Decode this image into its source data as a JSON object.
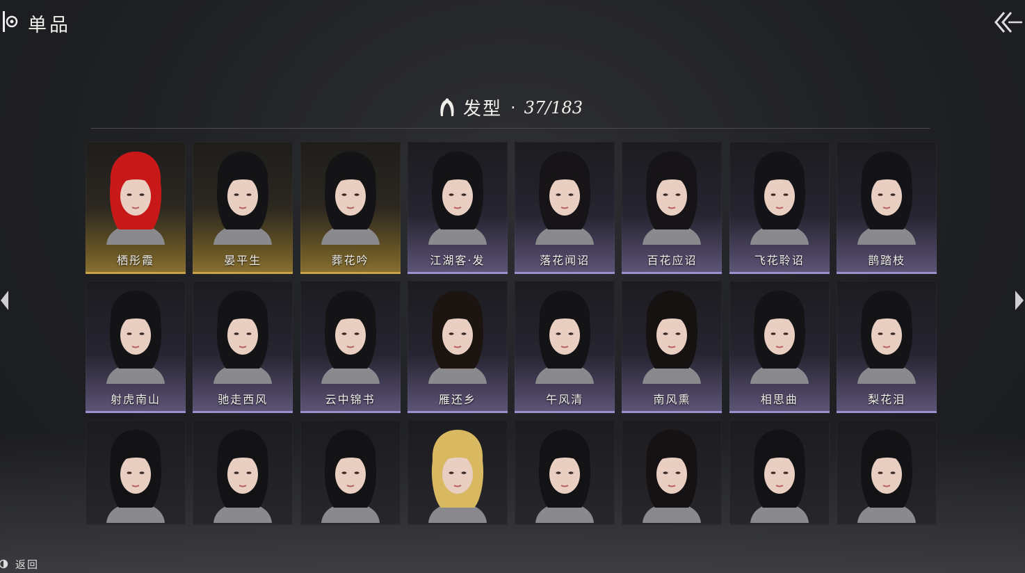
{
  "header": {
    "title": "单品"
  },
  "section": {
    "category": "发型",
    "separator": "·",
    "count": "37/183"
  },
  "cards": [
    {
      "name": "栖彤霞",
      "rarity": "gold",
      "hair": "#c81818"
    },
    {
      "name": "晏平生",
      "rarity": "gold",
      "hair": "#141416"
    },
    {
      "name": "葬花吟",
      "rarity": "gold",
      "hair": "#141416"
    },
    {
      "name": "江湖客·发",
      "rarity": "purple",
      "hair": "#141416"
    },
    {
      "name": "落花闻诏",
      "rarity": "purple",
      "hair": "#161416"
    },
    {
      "name": "百花应诏",
      "rarity": "purple",
      "hair": "#161416"
    },
    {
      "name": "飞花聆诏",
      "rarity": "purple",
      "hair": "#141418"
    },
    {
      "name": "鹊踏枝",
      "rarity": "purple",
      "hair": "#141418"
    },
    {
      "name": "射虎南山",
      "rarity": "purple",
      "hair": "#141416"
    },
    {
      "name": "驰走西风",
      "rarity": "purple",
      "hair": "#141416"
    },
    {
      "name": "云中锦书",
      "rarity": "purple",
      "hair": "#141416"
    },
    {
      "name": "雁还乡",
      "rarity": "purple",
      "hair": "#1c1410"
    },
    {
      "name": "午风清",
      "rarity": "purple",
      "hair": "#141416"
    },
    {
      "name": "南风熏",
      "rarity": "purple",
      "hair": "#161212"
    },
    {
      "name": "相思曲",
      "rarity": "purple",
      "hair": "#141416"
    },
    {
      "name": "梨花泪",
      "rarity": "purple",
      "hair": "#141416"
    },
    {
      "name": "",
      "rarity": "plain",
      "hair": "#131315"
    },
    {
      "name": "",
      "rarity": "plain",
      "hair": "#131315"
    },
    {
      "name": "",
      "rarity": "plain",
      "hair": "#131315"
    },
    {
      "name": "",
      "rarity": "plain",
      "hair": "#d8b860"
    },
    {
      "name": "",
      "rarity": "plain",
      "hair": "#131315"
    },
    {
      "name": "",
      "rarity": "plain",
      "hair": "#161214"
    },
    {
      "name": "",
      "rarity": "plain",
      "hair": "#131315"
    },
    {
      "name": "",
      "rarity": "plain",
      "hair": "#131315"
    }
  ],
  "footer": {
    "back_label": "返回"
  },
  "icons": {
    "logo": "logo-icon",
    "collapse": "double-chevron-left-icon",
    "hair": "hair-icon",
    "prev": "triangle-left-icon",
    "next": "triangle-right-icon",
    "back": "back-icon"
  }
}
